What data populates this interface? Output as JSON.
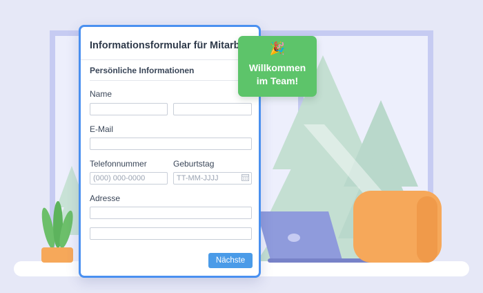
{
  "form": {
    "title": "Informationsformular für Mitarbeiter",
    "section": "Persönliche Informationen",
    "name_label": "Name",
    "email_label": "E-Mail",
    "phone_label": "Telefonnummer",
    "phone_placeholder": "(000) 000-0000",
    "birthday_label": "Geburtstag",
    "birthday_placeholder": "TT-MM-JJJJ",
    "address_label": "Adresse",
    "next_button": "Nächste"
  },
  "welcome": {
    "emoji": "🎉",
    "line1": "Willkommen",
    "line2": "im Team!"
  },
  "colors": {
    "background": "#e6e8f7",
    "form_border": "#4a90f0",
    "button": "#4a9be8",
    "welcome_card": "#5dc46a",
    "chair": "#f6a85a",
    "laptop": "#8f9bdc"
  },
  "icons": {
    "calendar": "calendar-icon",
    "party": "party-popper-icon"
  }
}
